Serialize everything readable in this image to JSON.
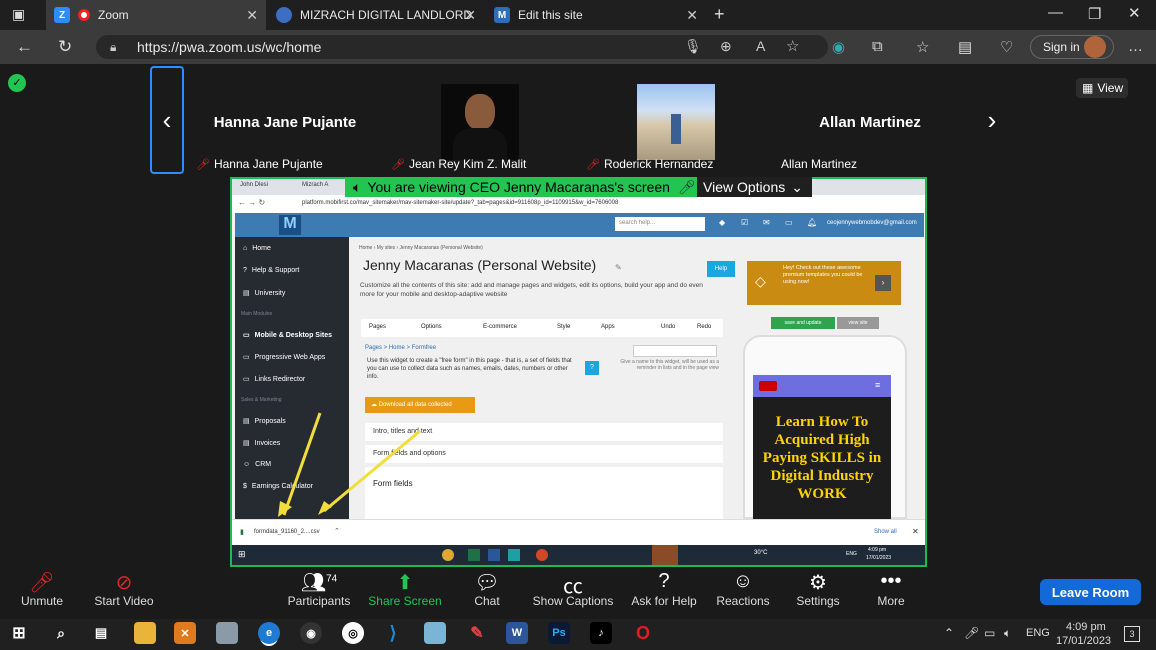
{
  "browser": {
    "tabs": [
      {
        "label": "Zoom",
        "icon": "zoom-icon"
      },
      {
        "label": "MIZRACH DIGITAL LANDLORD",
        "icon": "globe-icon"
      },
      {
        "label": "Edit this site",
        "icon": "m-logo-icon"
      }
    ],
    "url": "https://pwa.zoom.us/wc/home",
    "sign_in": "Sign in"
  },
  "zoom": {
    "view_label": "View",
    "participants_tiles": [
      {
        "big": "Hanna Jane Pujante",
        "name": "Hanna Jane Pujante"
      },
      {
        "big": "",
        "name": "Jean Rey Kim Z. Malit"
      },
      {
        "big": "",
        "name": "Roderick Hernandez"
      },
      {
        "big": "Allan Martinez",
        "name": "Allan Martinez"
      }
    ],
    "share_banner": "You are viewing CEO Jenny Macaranas's screen",
    "view_options": "View Options",
    "toolbar": {
      "unmute": "Unmute",
      "start_video": "Start Video",
      "participants": "Participants",
      "participants_count": "74",
      "share_screen": "Share Screen",
      "chat": "Chat",
      "show_captions": "Show Captions",
      "ask_for_help": "Ask for Help",
      "reactions": "Reactions",
      "settings": "Settings",
      "more": "More",
      "leave": "Leave Room"
    }
  },
  "shared": {
    "tab1": "John Dlesi",
    "tab2": "Mizrach A",
    "url": "platform.mobifirst.co/mav_sitemaker/mav-sitemaker-site/update?_tab=pages&id=911608p_id=1109915&w_id=7606008",
    "search_placeholder": "search help...",
    "email": "ceojennywebmobdev@gmail.com",
    "sidebar": [
      "Home",
      "Help & Support",
      "University",
      "Main Modules",
      "Mobile & Desktop Sites",
      "Progressive Web Apps",
      "Links Redirector",
      "Sales & Marketing",
      "Proposals",
      "Invoices",
      "CRM",
      "Earnings Calculator"
    ],
    "breadcrumb": "Home  ›  My sites  ›  Jenny Macaranas (Personal Website)",
    "title": "Jenny Macaranas (Personal Website)",
    "help": "Help",
    "desc": "Customize all the contents of this site: add and manage pages and widgets, edit its options, build your app and do even more for your mobile and desktop-adaptive website",
    "promo": "Hey! Check out these awesome premium templates you could be using now!",
    "toolbar": [
      "Pages",
      "Options",
      "E-commerce",
      "Style",
      "Apps",
      "Undo",
      "Redo"
    ],
    "save": "save and update",
    "view_site": "view site",
    "crumb2": "Pages > Home > Formfree",
    "widget_desc": "Use this widget to create a \"free form\" in this page - that is, a set of fields that you can use to collect data such as names, emails, dates, numbers or other info.",
    "name_hint": "Give a name to this widget, will be used as a reminder in lists and in the page view",
    "download": "Download all data collected",
    "intro": "Intro, titles and text",
    "form_opts": "Form fields and options",
    "form_fields": "Form fields",
    "phone_headline": "Learn How To Acquired High Paying SKILLS in Digital Industry WORK",
    "download_file": "formdata_91160_2....csv",
    "show_all": "Show all",
    "temp": "30°C",
    "lang": "ENG",
    "time": "4:09 pm",
    "date": "17/01/2023"
  },
  "taskbar": {
    "lang": "ENG",
    "time": "4:09 pm",
    "date": "17/01/2023",
    "notif": "3"
  },
  "colors": {
    "share_border": "#1db954",
    "leave": "#1469d9",
    "sidebar": "#262b31",
    "topbar": "#3e7bb2"
  }
}
